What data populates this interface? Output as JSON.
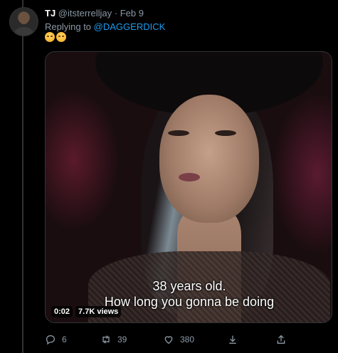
{
  "tweet": {
    "name": "TJ",
    "handle": "@itsterrelljay",
    "separator": "·",
    "date": "Feb 9",
    "replying_prefix": "Replying to",
    "replying_to": "@DAGGERDICK",
    "emojis": [
      "expressionless-face-icon",
      "rolling-eyes-face-icon"
    ]
  },
  "video": {
    "caption_line1": "38 years old.",
    "caption_line2": "How long you gonna be doing",
    "time": "0:02",
    "views": "7.7K views"
  },
  "actions": {
    "reply_count": "6",
    "retweet_count": "39",
    "like_count": "380"
  },
  "colors": {
    "background": "#000000",
    "accent": "#1d9bf0",
    "muted": "#8b98a5"
  }
}
